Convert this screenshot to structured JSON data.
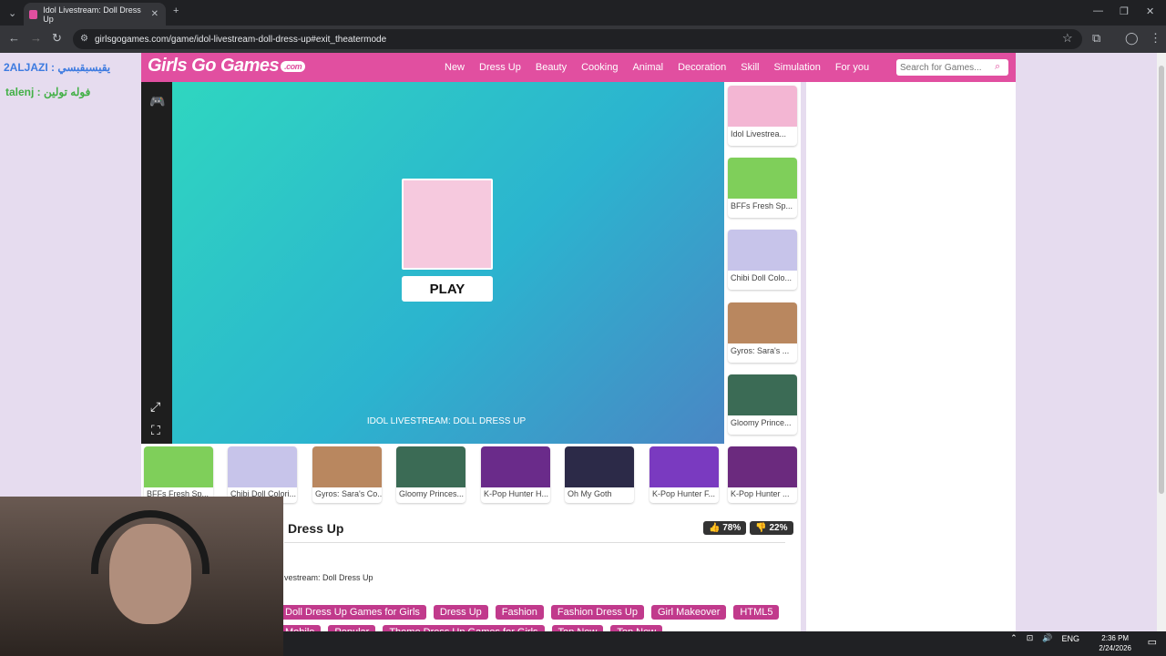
{
  "browser": {
    "tab_title": "Idol Livestream: Doll Dress Up",
    "tab_close": "✕",
    "new_tab": "+",
    "url": "girlsgogames.com/game/idol-livestream-doll-dress-up#exit_theatermode",
    "window_min": "—",
    "window_max": "❐",
    "window_close": "✕"
  },
  "overlay": {
    "line1": "2ALJAZI : يقيسبقبسي",
    "line2": "talenj : فوله تولين"
  },
  "site": {
    "logo_text": "Girls Go Games",
    "logo_com": ".com",
    "nav": [
      "New",
      "Dress Up",
      "Beauty",
      "Cooking",
      "Animal",
      "Decoration",
      "Skill",
      "Simulation",
      "For you"
    ],
    "search_placeholder": "Search for Games..."
  },
  "game": {
    "play_label": "PLAY",
    "title": "IDOL LIVESTREAM: DOLL DRESS UP"
  },
  "related": [
    {
      "label": "Idol Livestrea...",
      "color": "#f3b6d3"
    },
    {
      "label": "BFFs Fresh Sp...",
      "color": "#7fcf5a"
    },
    {
      "label": "Chibi Doll Colo...",
      "color": "#c7c4ea"
    },
    {
      "label": "Gyros: Sara's ...",
      "color": "#b9875f"
    },
    {
      "label": "Gloomy Prince...",
      "color": "#3b6b55"
    }
  ],
  "bottom_games": [
    {
      "label": "BFFs Fresh Sp...",
      "color": "#7fcf5a"
    },
    {
      "label": "Chibi Doll Colori...",
      "color": "#c7c4ea"
    },
    {
      "label": "Gyros: Sara's Co...",
      "color": "#b9875f"
    },
    {
      "label": "Gloomy Princes...",
      "color": "#3b6b55"
    },
    {
      "label": "K-Pop Hunter H...",
      "color": "#6a2b8a"
    },
    {
      "label": "Oh My Goth",
      "color": "#2c2a48"
    },
    {
      "label": "K-Pop Hunter F...",
      "color": "#7a3ac0"
    },
    {
      "label": "K-Pop Hunter ...",
      "color": "#6b2a7e"
    }
  ],
  "info": {
    "title": "Dress Up",
    "like_pct": "78%",
    "dislike_pct": "22%",
    "breadcrumb": "vestream: Doll Dress Up",
    "tags": [
      "Doll Dress Up Games for Girls",
      "Dress Up",
      "Fashion",
      "Fashion Dress Up",
      "Girl Makeover",
      "HTML5",
      "Mobile",
      "Popular",
      "Theme Dress Up Games for Girls",
      "Top New",
      "Top New"
    ]
  },
  "taskbar": {
    "lang": "ENG",
    "time": "2:36 PM",
    "date": "2/24/2026"
  }
}
